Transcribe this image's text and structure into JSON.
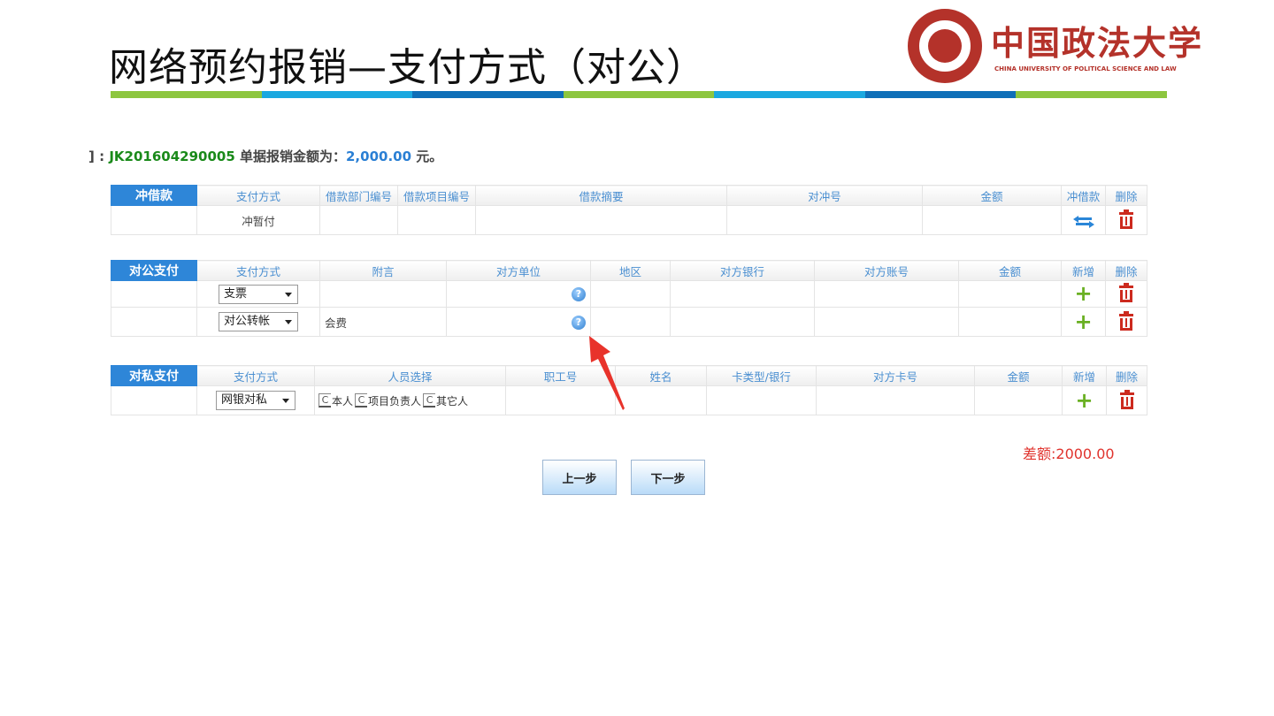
{
  "slide": {
    "title": "网络预约报销—支付方式（对公）",
    "bar_colors": [
      "#8dc63f",
      "#1aa8e0",
      "#0f6fb8",
      "#8dc63f",
      "#1aa8e0",
      "#0f6fb8",
      "#8dc63f"
    ]
  },
  "logo": {
    "cn": "中国政法大学",
    "en": "CHINA UNIVERSITY OF POLITICAL SCIENCE AND LAW"
  },
  "summary": {
    "prefix": "] : ",
    "doc_no": "JK201604290005",
    "label": " 单据报销金额为：",
    "amount": "2,000.00",
    "suffix": " 元。"
  },
  "loan_table": {
    "section": "冲借款",
    "headers": [
      "支付方式",
      "借款部门编号",
      "借款项目编号",
      "借款摘要",
      "对冲号",
      "金额",
      "冲借款",
      "删除"
    ],
    "row": {
      "method": "冲暂付"
    }
  },
  "public_table": {
    "section": "对公支付",
    "headers": [
      "支付方式",
      "附言",
      "对方单位",
      "地区",
      "对方银行",
      "对方账号",
      "金额",
      "新增",
      "删除"
    ],
    "rows": [
      {
        "method": "支票",
        "note": ""
      },
      {
        "method": "对公转帐",
        "note": "会费"
      }
    ]
  },
  "private_table": {
    "section": "对私支付",
    "headers": [
      "支付方式",
      "人员选择",
      "职工号",
      "姓名",
      "卡类型/银行",
      "对方卡号",
      "金额",
      "新增",
      "删除"
    ],
    "row": {
      "method": "网银对私",
      "options": [
        "本人",
        "项目负责人",
        "其它人"
      ]
    }
  },
  "diff": "差额:2000.00",
  "buttons": {
    "prev": "上一步",
    "next": "下一步"
  },
  "icons": {
    "help": "help-icon",
    "plus": "plus-icon",
    "delete": "trash-icon",
    "offset": "swap-icon",
    "dropdown": "chevron-down-icon"
  },
  "colors": {
    "section_header": "#2e86d8",
    "header_text": "#4a8fd1",
    "add": "#6ab023",
    "delete": "#cc2a1e",
    "diff": "#e0332d",
    "arrow": "#e8332b"
  }
}
